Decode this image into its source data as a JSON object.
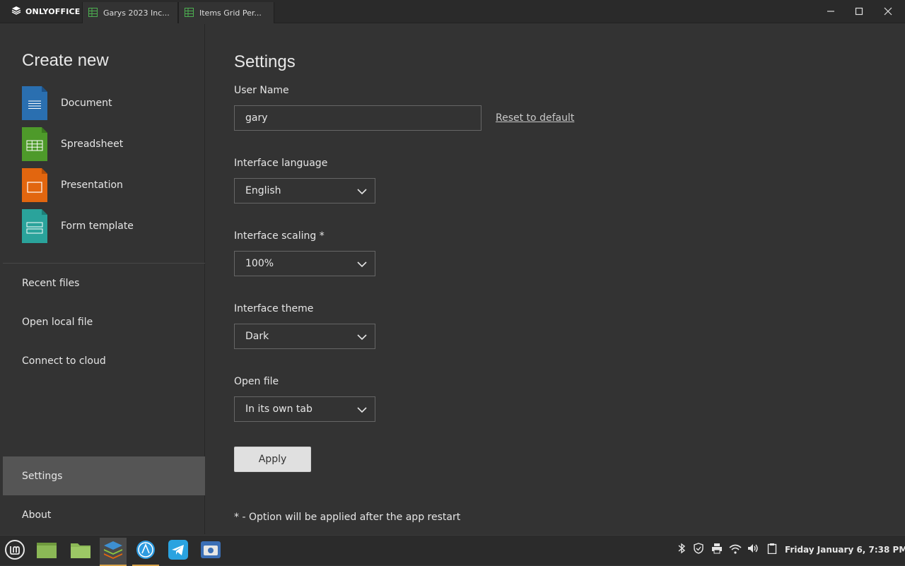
{
  "window": {
    "brand": "ONLYOFFICE",
    "tabs": [
      {
        "label": "Garys 2023 Inc...",
        "icon": "spreadsheet-tab-icon"
      },
      {
        "label": "Items Grid Per...",
        "icon": "spreadsheet-tab-icon"
      }
    ],
    "controls": [
      "minimize-icon",
      "maximize-icon",
      "close-icon"
    ]
  },
  "sidebar": {
    "create_title": "Create new",
    "create_items": [
      {
        "label": "Document",
        "color": "#2a6fb0"
      },
      {
        "label": "Spreadsheet",
        "color": "#4e9a2a"
      },
      {
        "label": "Presentation",
        "color": "#e2660f"
      },
      {
        "label": "Form template",
        "color": "#2aa39b"
      }
    ],
    "nav": [
      {
        "label": "Recent files"
      },
      {
        "label": "Open local file"
      },
      {
        "label": "Connect to cloud"
      },
      {
        "label": "Settings"
      },
      {
        "label": "About"
      }
    ]
  },
  "settings": {
    "title": "Settings",
    "user_name_label": "User Name",
    "user_name_value": "gary",
    "reset_label": "Reset to default",
    "language_label": "Interface language",
    "language_value": "English",
    "scaling_label": "Interface scaling *",
    "scaling_value": "100%",
    "theme_label": "Interface theme",
    "theme_value": "Dark",
    "open_file_label": "Open file",
    "open_file_value": "In its own tab",
    "apply_label": "Apply",
    "footnote": "* - Option will be applied after the app restart"
  },
  "taskbar": {
    "apps": [
      "mint-menu-icon",
      "files-icon",
      "folder-icon",
      "onlyoffice-icon",
      "browser-icon",
      "telegram-icon",
      "screenshot-icon"
    ],
    "tray": [
      "bluetooth-icon",
      "shield-icon",
      "printer-icon",
      "wifi-icon",
      "volume-icon",
      "clipboard-icon"
    ],
    "clock": "Friday January  6, 7:38 PM"
  }
}
